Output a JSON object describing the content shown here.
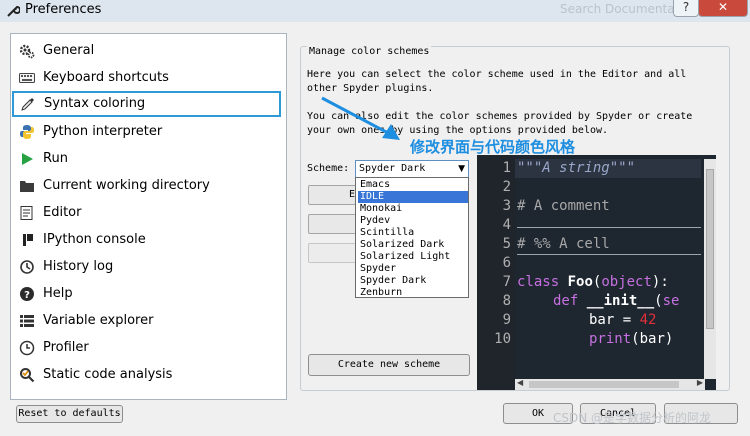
{
  "window": {
    "title": "Preferences",
    "background_title": "Search Documentation",
    "help_button": "?",
    "close_button": "✕"
  },
  "sidebar": {
    "items": [
      {
        "label": "General",
        "icon": "gears-icon"
      },
      {
        "label": "Keyboard shortcuts",
        "icon": "keyboard-icon"
      },
      {
        "label": "Syntax coloring",
        "icon": "eyedropper-icon",
        "selected": true
      },
      {
        "label": "Python interpreter",
        "icon": "python-icon"
      },
      {
        "label": "Run",
        "icon": "play-icon"
      },
      {
        "label": "Current working directory",
        "icon": "folder-icon"
      },
      {
        "label": "Editor",
        "icon": "editor-icon"
      },
      {
        "label": "IPython console",
        "icon": "ipython-icon"
      },
      {
        "label": "History log",
        "icon": "history-icon"
      },
      {
        "label": "Help",
        "icon": "help-icon"
      },
      {
        "label": "Variable explorer",
        "icon": "table-icon"
      },
      {
        "label": "Profiler",
        "icon": "clock-icon"
      },
      {
        "label": "Static code analysis",
        "icon": "magnifier-icon"
      }
    ]
  },
  "panel": {
    "group_title": "Manage color schemes",
    "desc_lines": [
      "Here you can select the color scheme used in the Editor and all",
      "other Spyder plugins.",
      "You can also edit the color schemes provided by Spyder or create",
      "your own ones by using the options provided below."
    ],
    "scheme_label": "Scheme:",
    "scheme_value": "Spyder Dark",
    "scheme_options": [
      "Emacs",
      "IDLE",
      "Monokai",
      "Pydev",
      "Scintilla",
      "Solarized Dark",
      "Solarized Light",
      "Spyder",
      "Spyder Dark",
      "Zenburn"
    ],
    "highlighted_option": "IDLE",
    "edit_button_partial": "E",
    "create_button": "Create new scheme"
  },
  "editor": {
    "line_numbers": [
      "1",
      "2",
      "3",
      "4",
      "5",
      "6",
      "7",
      "8",
      "9",
      "10"
    ],
    "line1": "\"\"\"A string\"\"\"",
    "line3": "# A comment",
    "line5": "# %% A cell",
    "line7_kw": "class",
    "line7_name": "Foo",
    "line7_paren_open": "(",
    "line7_builtin": "object",
    "line7_tail": "):",
    "line8_kw": "def",
    "line8_name": "__init__",
    "line8_paren": "(",
    "line8_partial": "se",
    "line9_var": "bar = ",
    "line9_num": "42",
    "line10_kw": "print",
    "line10_args": "(bar)"
  },
  "annotation": "修改界面与代码颜色风格",
  "footer": {
    "reset_button": "Reset to defaults",
    "ok_button": "OK",
    "cancel_button": "Cancel",
    "watermark": "CSDN @是学数据分析的阿龙"
  },
  "colors": {
    "selection_border": "#2d9ad6",
    "annotation_arrow": "#1e8ee0",
    "dropdown_highlight": "#3875d7",
    "editor_bg": "#1e2630",
    "string": "#9aa6c9",
    "comment": "#a8a8a8",
    "keyword": "#c670e0",
    "number": "#e0303c"
  }
}
